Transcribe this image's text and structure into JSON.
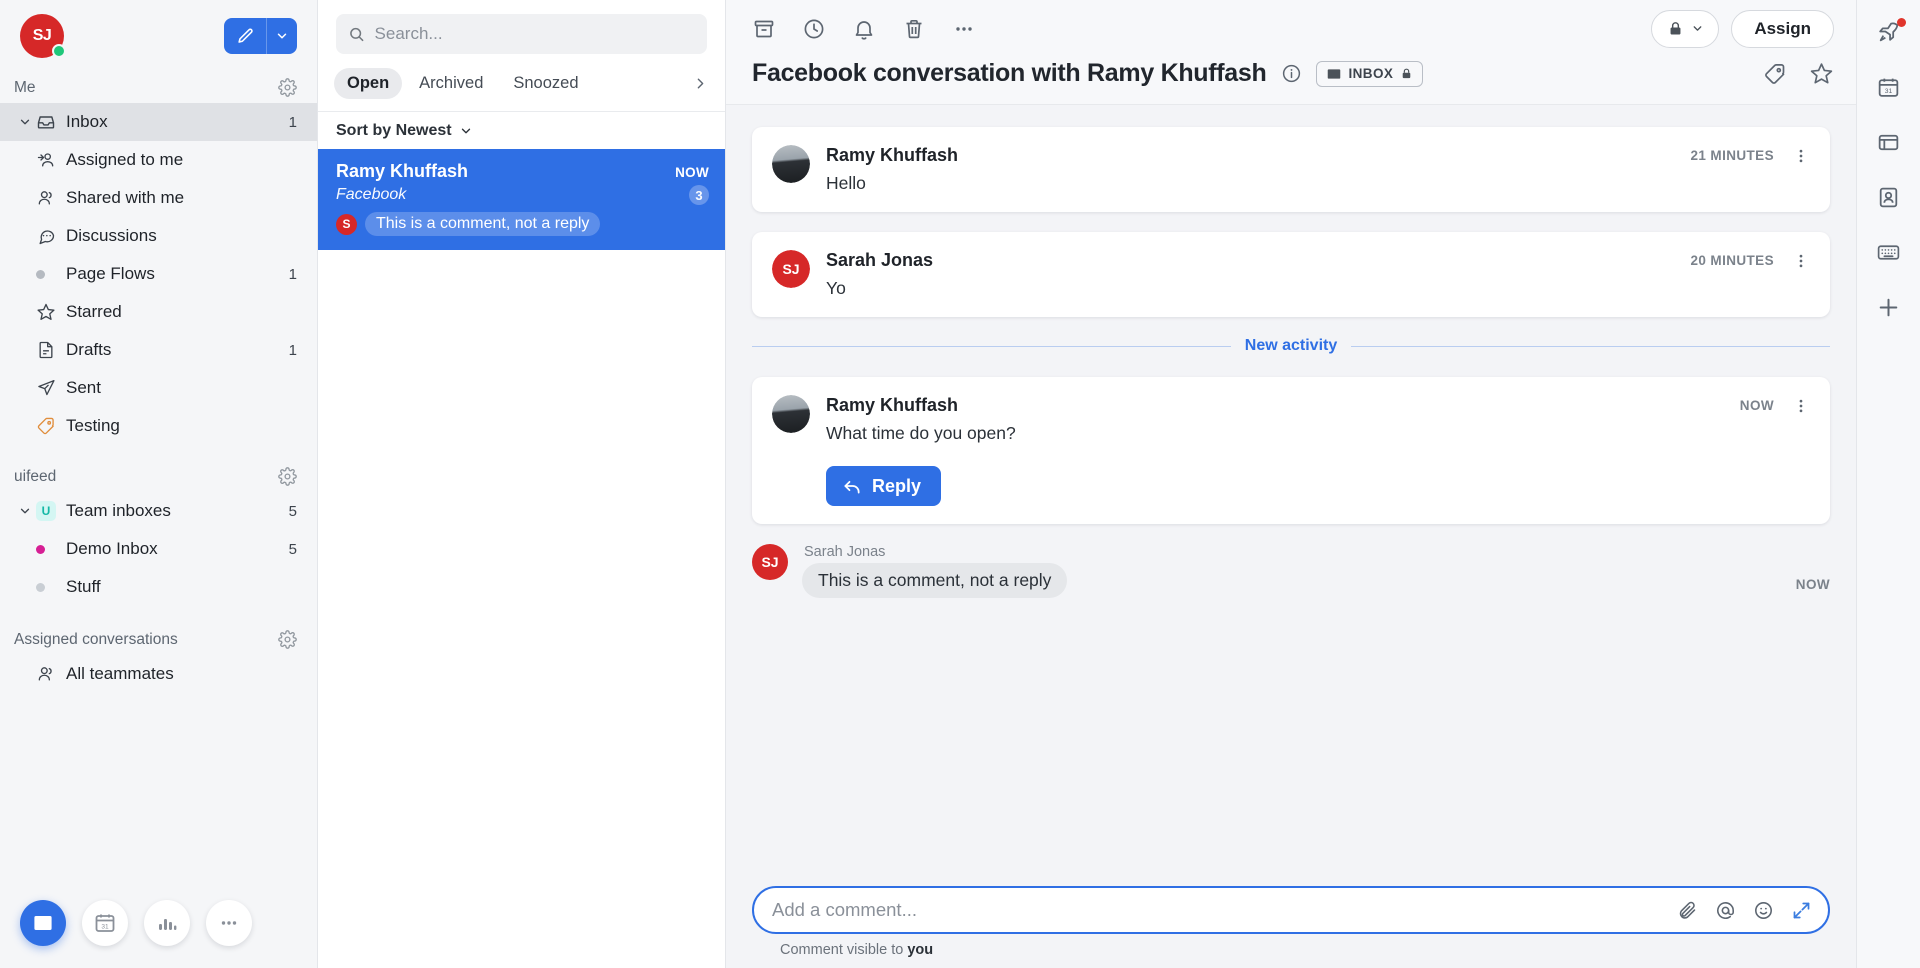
{
  "sidebar": {
    "user": {
      "initials": "SJ",
      "avatar_color": "#d62828",
      "presence_color": "#1fc77a"
    },
    "compose": {
      "label": "compose-new",
      "caret": "chevron-down"
    },
    "sections": [
      {
        "title": "Me",
        "items": [
          {
            "label": "Inbox",
            "count": "1",
            "icon": "inbox-icon",
            "active": true,
            "expandable": true
          },
          {
            "label": "Assigned to me",
            "count": "",
            "icon": "assigned-icon",
            "sub": true
          },
          {
            "label": "Shared with me",
            "count": "",
            "icon": "shared-icon",
            "sub": true
          },
          {
            "label": "Discussions",
            "count": "",
            "icon": "discussions-icon",
            "sub": true
          },
          {
            "label": "Page Flows",
            "count": "1",
            "icon": "dot-grey",
            "sub": true
          },
          {
            "label": "Starred",
            "count": "",
            "icon": "star-icon"
          },
          {
            "label": "Drafts",
            "count": "1",
            "icon": "drafts-icon"
          },
          {
            "label": "Sent",
            "count": "",
            "icon": "sent-icon"
          },
          {
            "label": "Testing",
            "count": "",
            "icon": "tag-icon"
          }
        ]
      },
      {
        "title": "uifeed",
        "items": [
          {
            "label": "Team inboxes",
            "count": "5",
            "icon": "team-badge-u",
            "expandable": true
          },
          {
            "label": "Demo Inbox",
            "count": "5",
            "icon": "dot-pink",
            "sub": true
          },
          {
            "label": "Stuff",
            "count": "",
            "icon": "dot-grey",
            "sub": true
          }
        ]
      },
      {
        "title": "Assigned conversations",
        "items": [
          {
            "label": "All teammates",
            "count": "",
            "icon": "teammates-icon"
          }
        ]
      }
    ],
    "dock": [
      {
        "name": "inbox-app",
        "icon": "inbox-icon",
        "active": true
      },
      {
        "name": "calendar-app",
        "icon": "calendar-icon",
        "active": false
      },
      {
        "name": "reports-app",
        "icon": "bar-chart-icon",
        "active": false
      },
      {
        "name": "more-apps",
        "icon": "ellipsis-icon",
        "active": false
      }
    ]
  },
  "list": {
    "search": {
      "placeholder": "Search...",
      "value": ""
    },
    "tabs": [
      {
        "label": "Open",
        "active": true
      },
      {
        "label": "Archived",
        "active": false
      },
      {
        "label": "Snoozed",
        "active": false
      }
    ],
    "sort": {
      "label": "Sort by Newest"
    },
    "conversations": [
      {
        "name": "Ramy Khuffash",
        "time": "NOW",
        "source": "Facebook",
        "unread_count": "3",
        "preview_badge": "S",
        "preview": "This is a comment, not a reply",
        "selected": true
      }
    ]
  },
  "main": {
    "toolbar": [
      {
        "name": "archive-icon"
      },
      {
        "name": "snooze-clock-icon"
      },
      {
        "name": "reminder-bell-icon"
      },
      {
        "name": "delete-trash-icon"
      },
      {
        "name": "more-ellipsis-icon"
      }
    ],
    "lock_pill": {
      "icon": "lock-icon",
      "caret": "chevron-down-icon"
    },
    "assign_label": "Assign",
    "title": "Facebook conversation with Ramy Khuffash",
    "info_icon": "info-icon",
    "inbox_chip": {
      "icon": "inbox-icon",
      "label": "INBOX",
      "lock": "lock-icon"
    },
    "head_right": [
      {
        "name": "tag-icon"
      },
      {
        "name": "star-icon"
      }
    ],
    "divider_label": "New activity",
    "messages": [
      {
        "author": "Ramy Khuffash",
        "avatar_type": "photo",
        "initials": "",
        "time": "21 MINUTES",
        "text": "Hello",
        "has_reply_button": false
      },
      {
        "author": "Sarah Jonas",
        "avatar_type": "initials",
        "initials": "SJ",
        "time": "20 MINUTES",
        "text": "Yo",
        "has_reply_button": false
      },
      {
        "author": "Ramy Khuffash",
        "avatar_type": "photo",
        "initials": "",
        "time": "NOW",
        "text": "What time do you open?",
        "has_reply_button": true,
        "reply_label": "Reply"
      }
    ],
    "comment": {
      "author": "Sarah Jonas",
      "initials": "SJ",
      "text": "This is a comment, not a reply",
      "time": "NOW"
    },
    "composer": {
      "placeholder": "Add a comment...",
      "value": "",
      "icons": [
        {
          "name": "attachment-icon"
        },
        {
          "name": "mention-icon"
        },
        {
          "name": "emoji-icon"
        },
        {
          "name": "expand-icon"
        }
      ],
      "note_prefix": "Comment visible to ",
      "note_target": "you"
    },
    "accent_color": "#2f6fe4"
  },
  "rail": [
    {
      "name": "rocket-icon",
      "has_dot": true
    },
    {
      "name": "calendar-icon",
      "has_dot": false
    },
    {
      "name": "cards-icon",
      "has_dot": false
    },
    {
      "name": "contact-icon",
      "has_dot": false
    },
    {
      "name": "keyboard-icon",
      "has_dot": false
    },
    {
      "name": "add-plus-icon",
      "has_dot": false
    }
  ]
}
